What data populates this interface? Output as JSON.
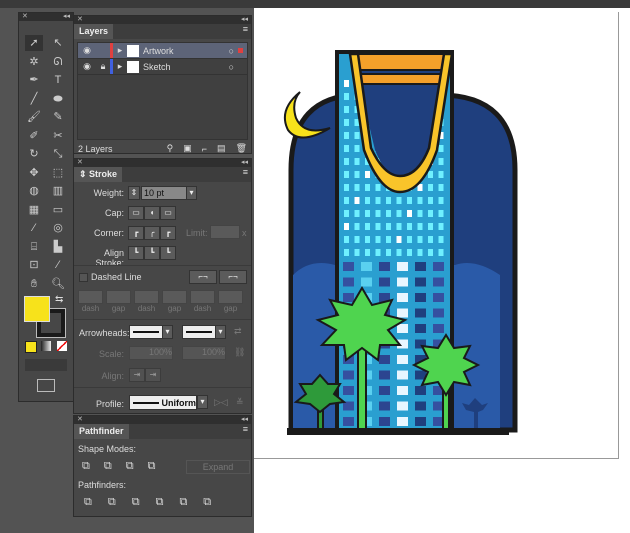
{
  "layers": {
    "title": "Layers",
    "items": [
      {
        "name": "Artwork",
        "color": "#e04040",
        "locked": false,
        "selected": true
      },
      {
        "name": "Sketch",
        "color": "#4060e0",
        "locked": true,
        "selected": false
      }
    ],
    "count": "2 Layers"
  },
  "stroke": {
    "title": "Stroke",
    "weight_label": "Weight:",
    "weight": "10 pt",
    "cap_label": "Cap:",
    "corner_label": "Corner:",
    "limit_label": "Limit:",
    "align_label": "Align Stroke:",
    "dashed_label": "Dashed Line",
    "dashed_checked": false,
    "dash_labels": [
      "dash",
      "gap",
      "dash",
      "gap",
      "dash",
      "gap"
    ],
    "arrowheads_label": "Arrowheads:",
    "scale_label": "Scale:",
    "scale1": "100%",
    "scale2": "100%",
    "align2_label": "Align:",
    "profile_label": "Profile:",
    "profile": "Uniform"
  },
  "pathfinder": {
    "title": "Pathfinder",
    "shape_modes_label": "Shape Modes:",
    "expand_label": "Expand",
    "pathfinders_label": "Pathfinders:"
  },
  "colors": {
    "fill": "#f7e21b",
    "stroke": "#1a1a1a"
  }
}
